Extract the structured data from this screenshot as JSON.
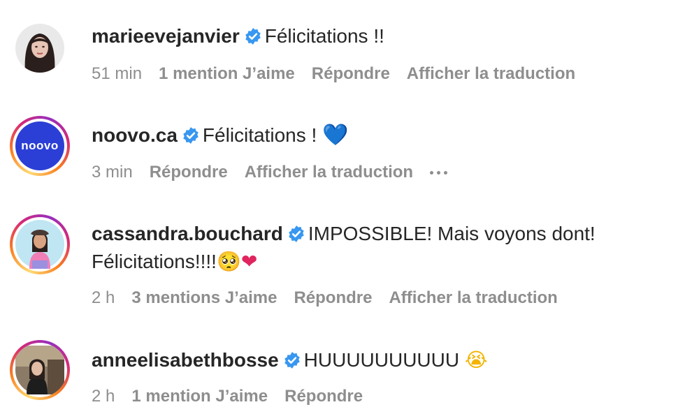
{
  "comments": [
    {
      "username": "marieevejanvier",
      "text": "Félicitations !!",
      "time": "51 min",
      "likes": "1 mention J’aime",
      "reply": "Répondre",
      "translate": "Afficher la traduction"
    },
    {
      "username": "noovo.ca",
      "text": "Félicitations ! ",
      "emoji": "💙",
      "avatar_text": "noovo",
      "time": "3 min",
      "reply": "Répondre",
      "translate": "Afficher la traduction"
    },
    {
      "username": "cassandra.bouchard",
      "text": "IMPOSSIBLE! Mais voyons dont!",
      "text_line2": "Félicitations!!!!",
      "emoji": "🥺",
      "emoji2": "❤",
      "time": "2 h",
      "likes": "3 mentions J’aime",
      "reply": "Répondre",
      "translate": "Afficher la traduction"
    },
    {
      "username": "anneelisabethbosse",
      "text": "HUUUUUUUUUU ",
      "emoji": "😭",
      "time": "2 h",
      "likes": "1 mention J’aime",
      "reply": "Répondre"
    }
  ],
  "colors": {
    "verified": "#3897f0",
    "meta": "#8e8e8e",
    "text": "#262626",
    "noovo_bg": "#2b3fd6"
  }
}
